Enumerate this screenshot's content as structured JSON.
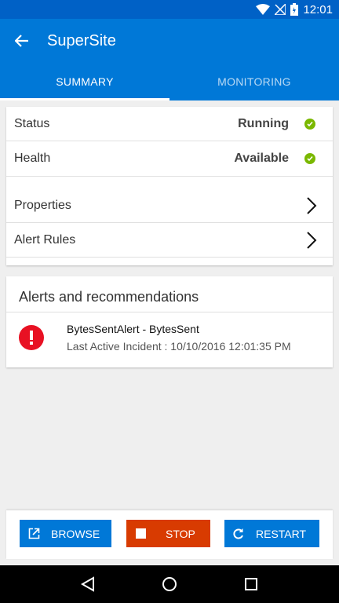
{
  "status_bar": {
    "time": "12:01"
  },
  "app_bar": {
    "title": "SuperSite"
  },
  "tabs": [
    {
      "label": "SUMMARY",
      "active": true
    },
    {
      "label": "MONITORING",
      "active": false
    }
  ],
  "status_card": {
    "rows": [
      {
        "label": "Status",
        "value": "Running",
        "indicator": "check-icon"
      },
      {
        "label": "Health",
        "value": "Available",
        "indicator": "check-icon"
      },
      {
        "label": "Properties",
        "indicator": "chevron-right-icon"
      },
      {
        "label": "Alert Rules",
        "indicator": "chevron-right-icon"
      }
    ]
  },
  "alerts": {
    "title": "Alerts and recommendations",
    "items": [
      {
        "name": "BytesSentAlert - BytesSent",
        "detail": "Last Active Incident : 10/10/2016 12:01:35 PM",
        "icon": "error-icon"
      }
    ]
  },
  "actions": {
    "browse": "BROWSE",
    "stop": "STOP",
    "restart": "RESTART"
  },
  "colors": {
    "primary": "#0078d7",
    "status_bar": "#0061c6",
    "stop": "#d83b01",
    "success": "#7ab800",
    "error": "#e81123"
  }
}
